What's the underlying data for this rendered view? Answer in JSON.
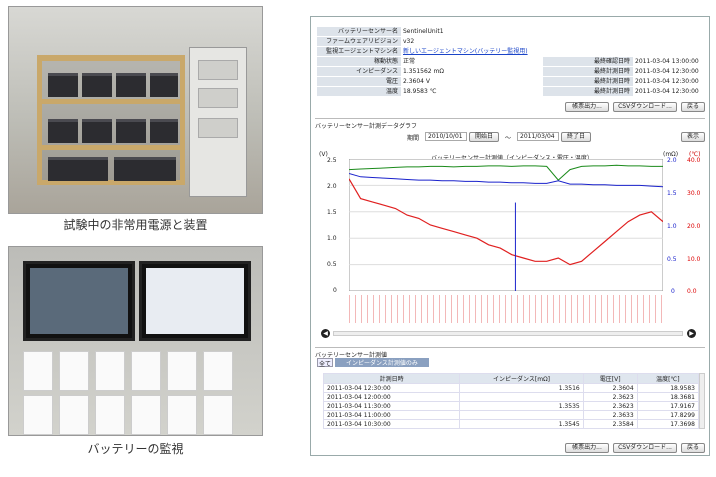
{
  "captions": {
    "photo1": "試験中の非常用電源と装置",
    "photo2": "バッテリーの監視"
  },
  "info": {
    "rows": [
      {
        "label": "バッテリーセンサー名",
        "value": "SentinelUnit1"
      },
      {
        "label": "ファームウェアリビジョン",
        "value": "v32"
      },
      {
        "label": "監視エージェントマシン名",
        "value": "新しいエージェントマシン(バッテリー監視用)"
      },
      {
        "label": "稼動状態",
        "value": "正常",
        "label2": "最終確認日時",
        "value2": "2011-03-04 13:00:00"
      },
      {
        "label": "インピーダンス",
        "value": "1.351562 mΩ",
        "label2": "最終計測日時",
        "value2": "2011-03-04 12:30:00"
      },
      {
        "label": "電圧",
        "value": "2.3604 V",
        "label2": "最終計測日時",
        "value2": "2011-03-04 12:30:00"
      },
      {
        "label": "温度",
        "value": "18.9583 ℃",
        "label2": "最終計測日時",
        "value2": "2011-03-04 12:30:00"
      }
    ],
    "buttons": [
      "帳票出力...",
      "CSVダウンロード...",
      "戻る"
    ]
  },
  "graph": {
    "section_title": "バッテリーセンサー計測データグラフ",
    "period_label": "期間",
    "from": "2010/10/01",
    "from_btn": "開始日",
    "tilde": "〜",
    "to": "2011/03/04",
    "to_btn": "終了日",
    "display_btn": "表示",
    "title": "バッテリーセンサー計測値（インピーダンス・電圧・温度）",
    "left_unit": "(V)",
    "mid_unit": "(mΩ)",
    "right_unit": "(℃)"
  },
  "chart_data": {
    "type": "line",
    "title": "バッテリーセンサー計測値（インピーダンス・電圧・温度）",
    "y_left_ticks": [
      "2.5",
      "2.0",
      "1.5",
      "1.0",
      "0.5",
      "0"
    ],
    "y_mid_ticks": [
      "2.0",
      "1.5",
      "1.0",
      "0.5",
      "0"
    ],
    "y_right_ticks": [
      "40.0",
      "30.0",
      "20.0",
      "10.0",
      "0.0"
    ],
    "series": [
      {
        "color": "#1a8a1a",
        "values": [
          2.3,
          2.31,
          2.32,
          2.33,
          2.34,
          2.35,
          2.35,
          2.36,
          2.36,
          2.35,
          2.36,
          2.36,
          2.37,
          2.37,
          2.36,
          2.37,
          2.37,
          2.36,
          2.1,
          2.3,
          2.36,
          2.37,
          2.37,
          2.38,
          2.37,
          2.37,
          2.36,
          2.36
        ]
      },
      {
        "color": "#1a22cc",
        "values": [
          1.78,
          1.73,
          1.72,
          1.71,
          1.7,
          1.69,
          1.68,
          1.68,
          1.67,
          1.67,
          1.66,
          1.66,
          1.65,
          1.65,
          1.64,
          1.64,
          1.63,
          1.63,
          1.67,
          1.62,
          1.62,
          1.61,
          1.61,
          1.6,
          1.6,
          1.6,
          1.59,
          1.58
        ]
      },
      {
        "color": "#e02020",
        "values": [
          34,
          28,
          27,
          26,
          25,
          23,
          22,
          20,
          19,
          18,
          17,
          16,
          14,
          13,
          11,
          10,
          9,
          9,
          10,
          8,
          9,
          12,
          15,
          18,
          21,
          23,
          24,
          21
        ]
      }
    ]
  },
  "table": {
    "section_title": "バッテリーセンサー計測値",
    "tabs": [
      "全て",
      "インピーダンス計測値のみ"
    ],
    "headers": [
      "計測日時",
      "インピーダンス[mΩ]",
      "電圧[V]",
      "温度[℃]"
    ],
    "rows": [
      [
        "2011-03-04 12:30:00",
        "1.3516",
        "2.3604",
        "18.9583"
      ],
      [
        "2011-03-04 12:00:00",
        "",
        "2.3623",
        "18.3681"
      ],
      [
        "2011-03-04 11:30:00",
        "1.3535",
        "2.3623",
        "17.9167"
      ],
      [
        "2011-03-04 11:00:00",
        "",
        "2.3633",
        "17.8299"
      ],
      [
        "2011-03-04 10:30:00",
        "1.3545",
        "2.3584",
        "17.3698"
      ]
    ],
    "buttons": [
      "帳票出力...",
      "CSVダウンロード...",
      "戻る"
    ]
  }
}
